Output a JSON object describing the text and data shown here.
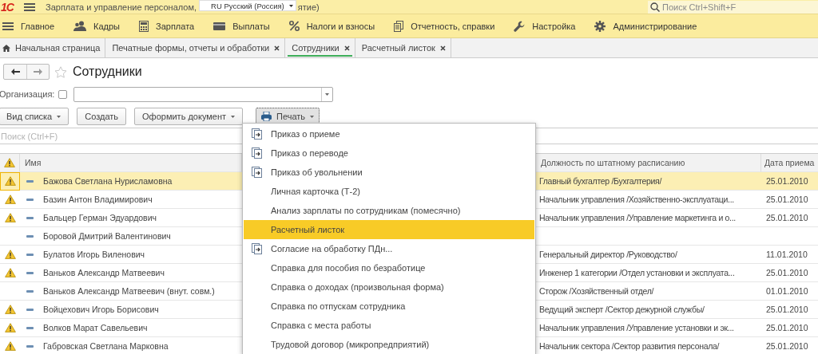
{
  "app_bar": {
    "logo": "1С",
    "title_start": "Зарплата и управление персоналом,",
    "title_end": "ятие)",
    "search": {
      "placeholder": "Поиск Ctrl+Shift+F"
    }
  },
  "language_dropdown": {
    "value": "RU Русский (Россия)"
  },
  "sections": [
    {
      "label": "Главное",
      "kind": "menu"
    },
    {
      "label": "Кадры",
      "kind": "people"
    },
    {
      "label": "Зарплата",
      "kind": "calculator"
    },
    {
      "label": "Выплаты",
      "kind": "card"
    },
    {
      "label": "Налоги и взносы",
      "kind": "percent"
    },
    {
      "label": "Отчетность, справки",
      "kind": "documents"
    },
    {
      "label": "Настройка",
      "kind": "wrench"
    },
    {
      "label": "Администрирование",
      "kind": "gear"
    }
  ],
  "tabs": [
    {
      "label": "Начальная страница",
      "kind": "home",
      "selected": false
    },
    {
      "label": "Печатные формы, отчеты и обработки",
      "kind": "closable",
      "selected": false
    },
    {
      "label": "Сотрудники",
      "kind": "closable",
      "selected": true
    },
    {
      "label": "Расчетный листок",
      "kind": "closable",
      "selected": false
    }
  ],
  "form": {
    "title": "Сотрудники",
    "organization": {
      "label": "Организация:",
      "checked": false
    },
    "buttons": [
      {
        "label": "Вид списка",
        "kind": "dropdown",
        "pressed": false
      },
      {
        "label": "Создать",
        "kind": "plain",
        "pressed": false
      },
      {
        "label": "Оформить документ",
        "kind": "dropdown",
        "pressed": false
      },
      {
        "label": "Печать",
        "kind": "print-dropdown",
        "pressed": true
      }
    ],
    "search": {
      "placeholder": "Поиск (Ctrl+F)"
    }
  },
  "table": {
    "columns": [
      {
        "kind": "warning"
      },
      {
        "kind": "name",
        "label": "Имя"
      },
      {
        "kind": "position",
        "label": "Должность по штатному расписанию"
      },
      {
        "kind": "date",
        "label": "Дата приема"
      }
    ],
    "rows": [
      {
        "warning": true,
        "selected": true,
        "name": "Бажова Светлана Нурисламовна",
        "position": "Главный бухгалтер /Бухгалтерия/",
        "hire_date": "25.01.2010"
      },
      {
        "warning": true,
        "selected": false,
        "name": "Базин Антон Владимирович",
        "position": "Начальник управления /Хозяйственно-эксплуатаци...",
        "hire_date": "25.01.2010"
      },
      {
        "warning": true,
        "selected": false,
        "name": "Бальцер Герман Эдуардович",
        "position": "Начальник управления /Управление маркетинга и о...",
        "hire_date": "25.01.2010"
      },
      {
        "warning": false,
        "selected": false,
        "name": "Боровой Дмитрий Валентинович"
      },
      {
        "warning": true,
        "selected": false,
        "name": "Булатов Игорь Виленович",
        "position": "Генеральный директор /Руководство/",
        "hire_date": "11.01.2010"
      },
      {
        "warning": true,
        "selected": false,
        "name": "Ваньков Александр Матвеевич",
        "position": "Инженер 1 категории /Отдел установки и эксплуата...",
        "hire_date": "25.01.2010"
      },
      {
        "warning": false,
        "selected": false,
        "name": "Ваньков Александр Матвеевич (внут. совм.)",
        "position": "Сторож /Хозяйственный отдел/",
        "hire_date": "01.01.2010"
      },
      {
        "warning": true,
        "selected": false,
        "name": "Войцехович Игорь Борисович",
        "position": "Ведущий эксперт /Сектор дежурной службы/",
        "hire_date": "25.01.2010"
      },
      {
        "warning": true,
        "selected": false,
        "name": "Волков Марат Савельевич",
        "position": "Начальник управления /Управление установки и эк...",
        "hire_date": "25.01.2010"
      },
      {
        "warning": true,
        "selected": false,
        "name": "Габровская Светлана Марковна",
        "position": "Начальник сектора /Сектор развития персонала/",
        "hire_date": "25.01.2010"
      }
    ]
  },
  "print_menu": {
    "items": [
      {
        "label": "Приказ о приеме",
        "kind": "document",
        "selected": false
      },
      {
        "label": "Приказ о переводе",
        "kind": "document",
        "selected": false
      },
      {
        "label": "Приказ об увольнении",
        "kind": "document",
        "selected": false
      },
      {
        "label": "Личная карточка (Т-2)",
        "kind": "plain",
        "selected": false
      },
      {
        "label": "Анализ зарплаты по сотрудникам (помесячно)",
        "kind": "plain",
        "selected": false
      },
      {
        "label": "Расчетный листок",
        "kind": "plain",
        "selected": true
      },
      {
        "label": "Согласие на обработку ПДн...",
        "kind": "document",
        "selected": false
      },
      {
        "label": "Справка для пособия по безработице",
        "kind": "plain",
        "selected": false
      },
      {
        "label": "Справка о доходах (произвольная форма)",
        "kind": "plain",
        "selected": false
      },
      {
        "label": "Справка по отпускам сотрудника",
        "kind": "plain",
        "selected": false
      },
      {
        "label": "Справка с места работы",
        "kind": "plain",
        "selected": false
      },
      {
        "label": "Трудовой договор (микропредприятий)",
        "kind": "plain",
        "selected": false
      }
    ]
  }
}
